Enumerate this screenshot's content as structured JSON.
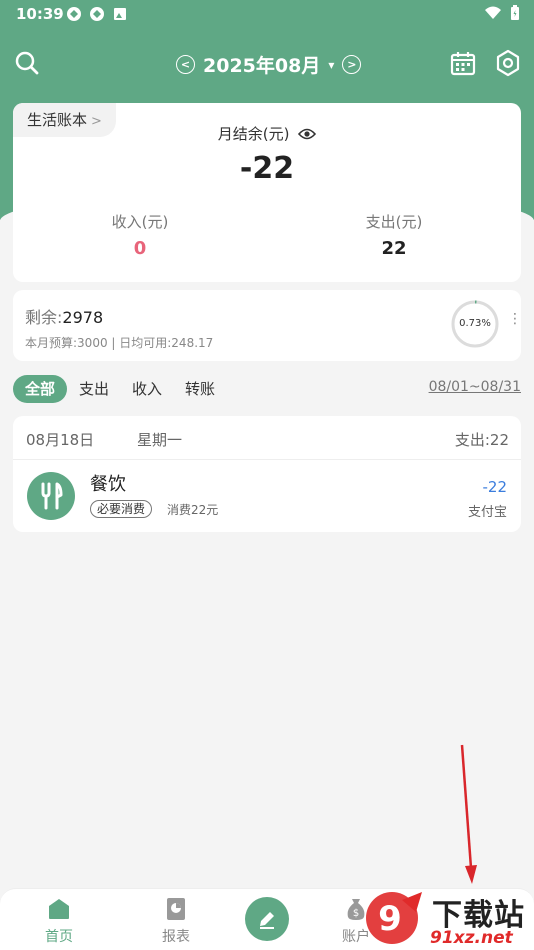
{
  "status_bar": {
    "time": "10:39"
  },
  "topbar": {
    "month": "2025年08月",
    "month_caret": "▾",
    "prev_icon": "chevron-left-icon",
    "next_icon": "chevron-right-icon",
    "search_icon": "search-icon",
    "calendar_icon": "calendar-icon",
    "settings_icon": "settings-icon"
  },
  "summary": {
    "book_name": "生活账本",
    "book_chevron": ">",
    "balance_label": "月结余(元)",
    "balance": "-22",
    "income_label": "收入(元)",
    "income": "0",
    "expense_label": "支出(元)",
    "expense": "22"
  },
  "budget": {
    "remain_label": "剩余:",
    "remain_value": "2978",
    "detail": "本月预算:3000 | 日均可用:248.17",
    "percent_text": "0.73%",
    "percent_fraction": 0.0073,
    "more": "⋮"
  },
  "filters": {
    "tabs": [
      "全部",
      "支出",
      "收入",
      "转账"
    ],
    "active_index": 0,
    "date_range": "08/01~08/31"
  },
  "day_groups": [
    {
      "date": "08月18日",
      "weekday": "星期一",
      "expense_summary": "支出:22",
      "records": [
        {
          "category": "餐饮",
          "icon": "fork-knife-icon",
          "tag": "必要消费",
          "note": "消费22元",
          "amount": "-22",
          "account": "支付宝"
        }
      ]
    }
  ],
  "bottom_nav": {
    "items": [
      "首页",
      "报表",
      "账户"
    ],
    "active_index": 0
  },
  "watermark": {
    "big": "下载站",
    "small": "91xz.net"
  },
  "colors": {
    "primary": "#5fa885",
    "income": "#e8647a",
    "expense_amount": "#3b7ddd",
    "background": "#f4f4f4",
    "annotation_arrow": "#d9262b"
  }
}
